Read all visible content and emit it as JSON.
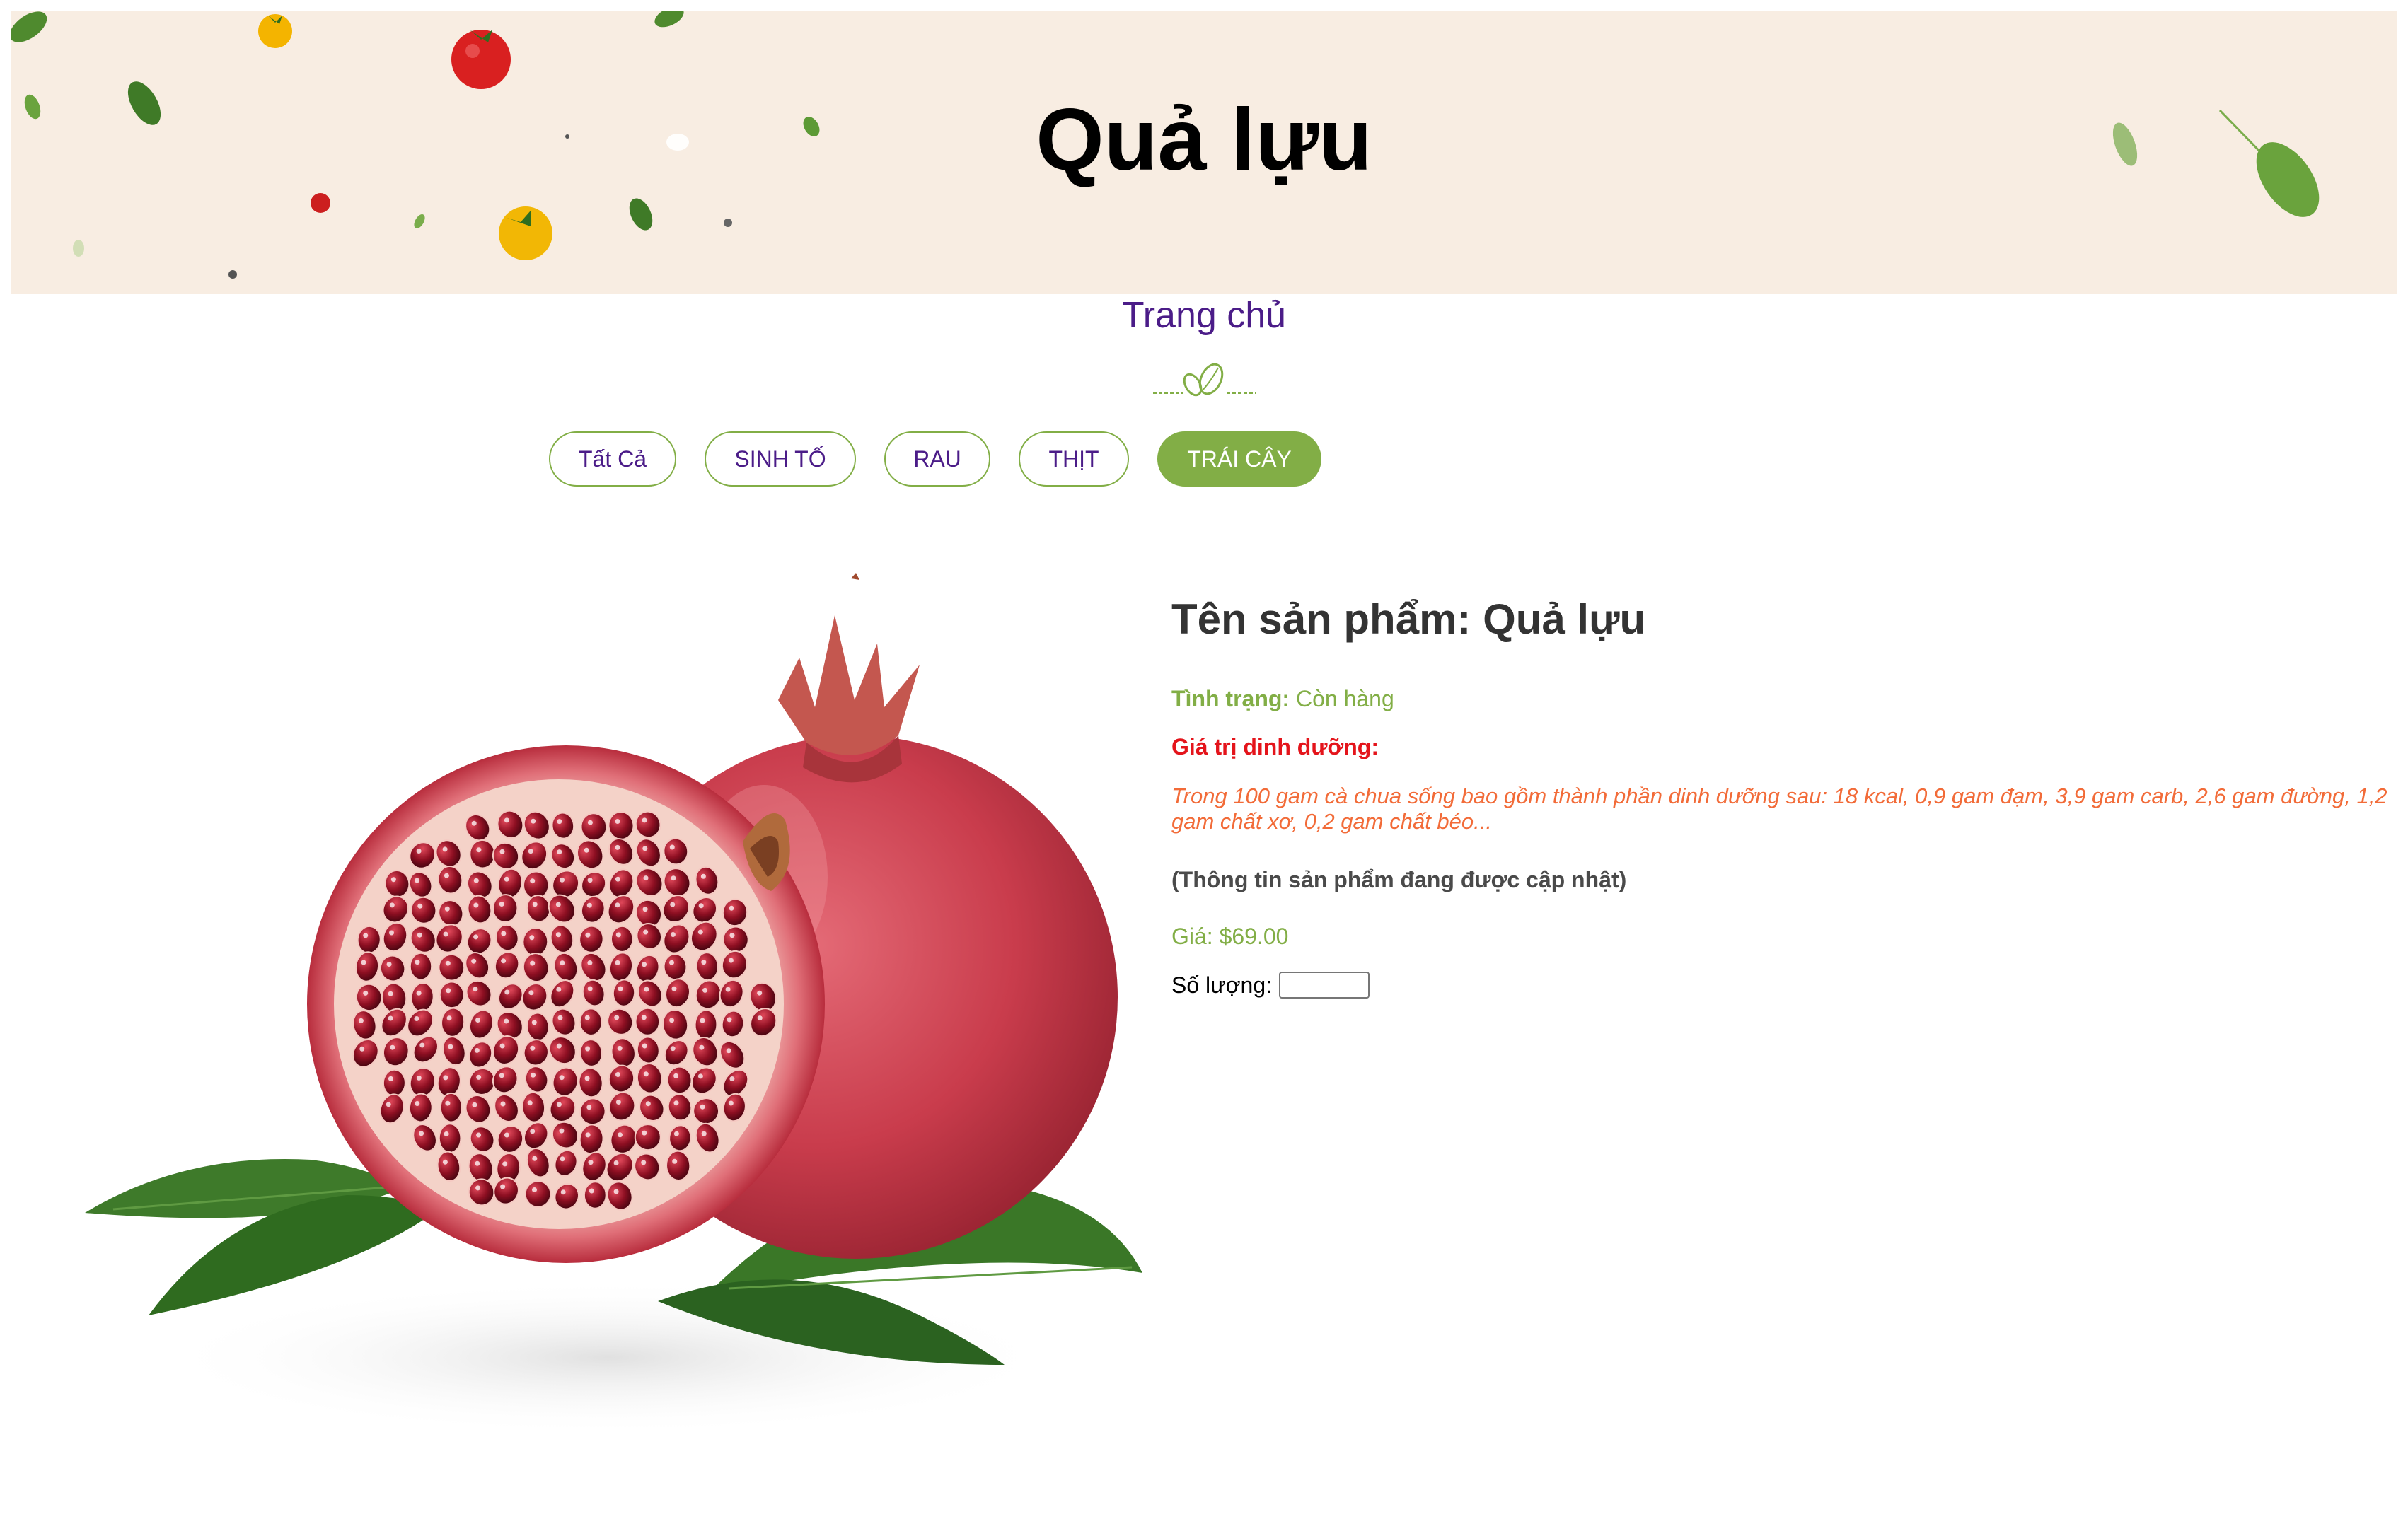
{
  "hero": {
    "title": "Quả lựu",
    "background_color": "#f8ede2"
  },
  "breadcrumb": {
    "home_label": "Trang chủ"
  },
  "divider_icon": "leaf-divider-icon",
  "filters": [
    {
      "label": "Tất Cả",
      "active": false
    },
    {
      "label": "SINH TỐ",
      "active": false
    },
    {
      "label": "RAU",
      "active": false
    },
    {
      "label": "THỊT",
      "active": false
    },
    {
      "label": "TRÁI CÂY",
      "active": true
    }
  ],
  "product": {
    "image_icon": "pomegranate-image",
    "name_heading": "Tên sản phẩm: Quả lựu",
    "status_label": "Tình trạng:",
    "status_value": "Còn hàng",
    "nutrition_label": "Giá trị dinh dưỡng:",
    "nutrition_text": "Trong 100 gam cà chua sống bao gồm thành phần dinh dưỡng sau: 18 kcal, 0,9 gam đạm, 3,9 gam carb, 2,6 gam đường, 1,2 gam chất xơ, 0,2 gam chất béo...",
    "notice": "(Thông tin sản phẩm đang được cập nhật)",
    "price_text": "Giá: $69.00",
    "quantity_label": "Số lượng:",
    "quantity_value": ""
  },
  "colors": {
    "accent_green": "#82ae46",
    "link_purple": "#4b1c88",
    "nutrition_red": "#e4141b",
    "nutrition_orange": "#f26b38"
  }
}
